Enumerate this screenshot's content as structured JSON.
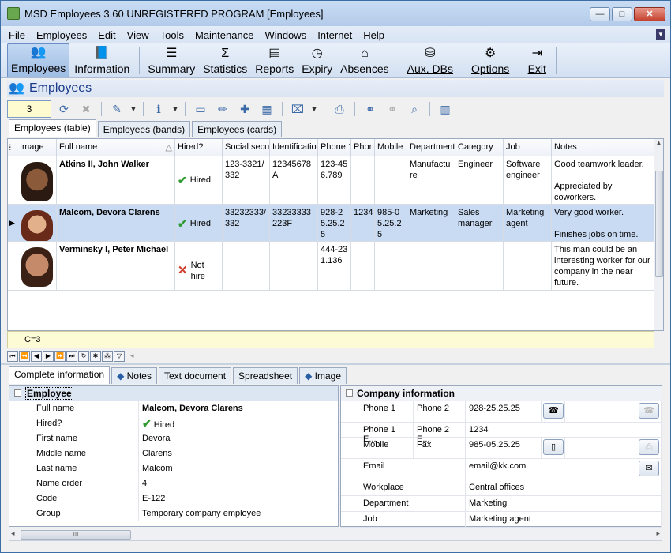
{
  "window": {
    "title": "MSD Employees 3.60 UNREGISTERED PROGRAM [Employees]"
  },
  "menu": [
    "File",
    "Employees",
    "Edit",
    "View",
    "Tools",
    "Maintenance",
    "Windows",
    "Internet",
    "Help"
  ],
  "toolbar": [
    {
      "label": "Employees",
      "icon": "people-icon",
      "active": true
    },
    {
      "label": "Information",
      "icon": "book-icon"
    },
    {
      "label": "Summary",
      "icon": "list-icon"
    },
    {
      "label": "Statistics",
      "icon": "sigma-icon"
    },
    {
      "label": "Reports",
      "icon": "report-icon"
    },
    {
      "label": "Expiry",
      "icon": "clock-icon"
    },
    {
      "label": "Absences",
      "icon": "house-icon"
    },
    {
      "label": "Aux. DBs",
      "icon": "database-icon"
    },
    {
      "label": "Options",
      "icon": "gear-icon"
    },
    {
      "label": "Exit",
      "icon": "exit-icon"
    }
  ],
  "section": {
    "title": "Employees"
  },
  "record_count": "3",
  "view_tabs": [
    "Employees (table)",
    "Employees (bands)",
    "Employees (cards)"
  ],
  "columns": [
    "Image",
    "Full name",
    "Hired?",
    "Social secu",
    "Identificatio",
    "Phone 1",
    "Phon",
    "Mobile",
    "Department",
    "Category",
    "Job",
    "Notes"
  ],
  "rows": [
    {
      "name": "Atkins II, John Walker",
      "hired": "Hired",
      "hired_flag": true,
      "ssn": "123-3321/332",
      "id": "12345678A",
      "phone1": "123-456.789",
      "phone2": "",
      "mobile": "",
      "dept": "Manufacture",
      "category": "Engineer",
      "job": "Software engineer",
      "notes1": "Good teamwork leader.",
      "notes2": "Appreciated by coworkers.",
      "selected": false
    },
    {
      "name": "Malcom, Devora Clarens",
      "hired": "Hired",
      "hired_flag": true,
      "ssn": "33232333/332",
      "id": "33233333223F",
      "phone1": "928-25.25.25",
      "phone2": "1234",
      "mobile": "985-05.25.25",
      "dept": "Marketing",
      "category": "Sales manager",
      "job": "Marketing agent",
      "notes1": "Very good worker.",
      "notes2": "Finishes jobs on time.",
      "selected": true
    },
    {
      "name": "Verminsky I, Peter Michael",
      "hired": "Not hire",
      "hired_flag": false,
      "ssn": "",
      "id": "",
      "phone1": "444-231.136",
      "phone2": "",
      "mobile": "",
      "dept": "",
      "category": "",
      "job": "",
      "notes1": "This man could be an interesting worker for our company in the near future.",
      "notes2": "",
      "selected": false
    }
  ],
  "footer_count": "C=3",
  "detail_tabs": [
    "Complete information",
    "Notes",
    "Text document",
    "Spreadsheet",
    "Image"
  ],
  "employee_panel": {
    "title": "Employee",
    "fields": [
      {
        "label": "Full name",
        "value": "Malcom, Devora Clarens"
      },
      {
        "label": "Hired?",
        "value": "Hired"
      },
      {
        "label": "First name",
        "value": "Devora"
      },
      {
        "label": "Middle name",
        "value": "Clarens"
      },
      {
        "label": "Last name",
        "value": "Malcom"
      },
      {
        "label": "Name order",
        "value": "4"
      },
      {
        "label": "Code",
        "value": "E-122"
      },
      {
        "label": "Group",
        "value": "Temporary company employee"
      }
    ]
  },
  "company_panel": {
    "title": "Company information",
    "phone1": "Phone 1",
    "phone2": "Phone 2",
    "phone2_val": "928-25.25.25",
    "phone1e": "Phone 1 E...",
    "phone2e": "Phone 2 E...",
    "phone2e_val": "1234",
    "mobile": "Mobile",
    "fax": "Fax",
    "fax_val": "985-05.25.25",
    "email": "Email",
    "email_val": "email@kk.com",
    "workplace": "Workplace",
    "workplace_val": "Central offices",
    "department": "Department",
    "department_val": "Marketing",
    "job": "Job",
    "job_val": "Marketing agent"
  }
}
